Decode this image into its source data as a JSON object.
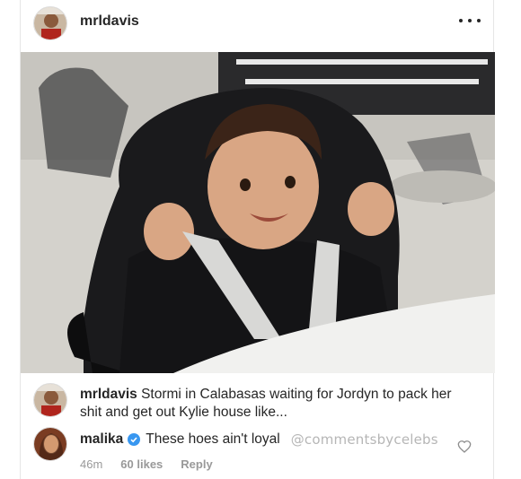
{
  "post": {
    "author": "mrldavis",
    "caption_username": "mrldavis",
    "caption_text": "Stormi in Calabasas waiting for Jordyn to pack her shit and get out Kylie house like..."
  },
  "comment": {
    "username": "malika",
    "text": "These hoes ain't loyal",
    "watermark": "@commentsbycelebs",
    "time": "46m",
    "likes": "60 likes",
    "reply_label": "Reply"
  },
  "icons": {
    "more": "more-options-icon",
    "verified": "verified-badge-icon",
    "heart": "heart-outline-icon"
  },
  "colors": {
    "verified": "#3897f0",
    "meta_text": "#999999",
    "watermark": "#b6b6b6"
  }
}
